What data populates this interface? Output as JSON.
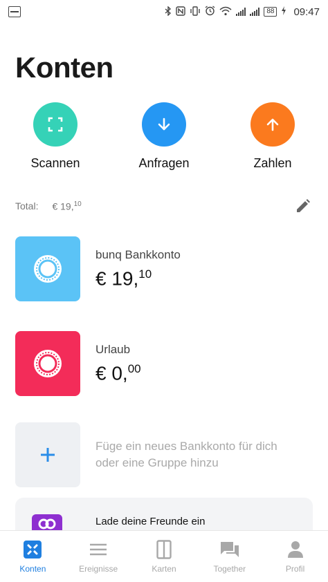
{
  "status_bar": {
    "time": "09:47",
    "battery": "88",
    "icons": [
      "activity-icon",
      "bluetooth-icon",
      "nfc-icon",
      "vibrate-icon",
      "alarm-icon",
      "wifi-icon",
      "signal-icon",
      "signal-icon",
      "battery-icon",
      "charging-icon"
    ]
  },
  "page": {
    "title": "Konten"
  },
  "actions": [
    {
      "label": "Scannen",
      "icon": "scan-icon",
      "color": "#35d2b7"
    },
    {
      "label": "Anfragen",
      "icon": "arrow-down-icon",
      "color": "#2597f3"
    },
    {
      "label": "Zahlen",
      "icon": "arrow-up-icon",
      "color": "#fb7a1e"
    }
  ],
  "total": {
    "label": "Total:",
    "amount_main": "€ 19,",
    "amount_cents": "10",
    "edit_icon": "pencil-icon"
  },
  "accounts": [
    {
      "name": "bunq Bankkonto",
      "balance_main": "€ 19,",
      "balance_cents": "10",
      "color": "#5bc3f6",
      "icon": "account-ring-icon"
    },
    {
      "name": "Urlaub",
      "balance_main": "€ 0,",
      "balance_cents": "00",
      "color": "#f32c59",
      "icon": "account-ring-icon"
    }
  ],
  "add_account": {
    "text_line1": "Füge ein neues Bankkonto für dich",
    "text_line2": "oder eine Gruppe hinzu",
    "icon": "plus-icon"
  },
  "invite": {
    "text": "Lade deine Freunde ein",
    "icon": "gift-icon",
    "color": "#8e2fd0"
  },
  "nav": [
    {
      "label": "Konten",
      "icon": "bunq-logo-icon",
      "active": true
    },
    {
      "label": "Ereignisse",
      "icon": "menu-lines-icon",
      "active": false
    },
    {
      "label": "Karten",
      "icon": "cards-icon",
      "active": false
    },
    {
      "label": "Together",
      "icon": "chat-icon",
      "active": false
    },
    {
      "label": "Profil",
      "icon": "person-icon",
      "active": false
    }
  ],
  "colors": {
    "active": "#1f7fe0",
    "inactive": "#a8a8a8"
  }
}
